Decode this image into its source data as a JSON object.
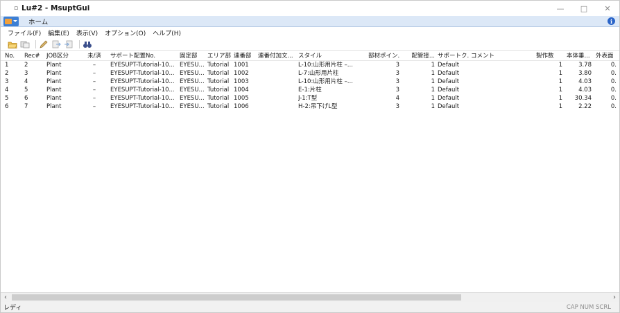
{
  "titlebar": {
    "glyph": "▫",
    "title": "Lu#2 - MsuptGui",
    "minimize": "—",
    "maximize": "□",
    "close": "✕"
  },
  "ribbon": {
    "home_tab": "ホーム",
    "info": "i"
  },
  "menu": [
    "ファイル(F)",
    "編集(E)",
    "表示(V)",
    "オプション(O)",
    "ヘルプ(H)"
  ],
  "toolbar": {
    "icons": [
      "open-folder-icon",
      "copy-rows-icon",
      "edit-pencil-icon",
      "export-icon",
      "import-icon",
      "find-binoculars-icon"
    ]
  },
  "columns": [
    "No.",
    "Rec#",
    "JOB区分",
    "未/済",
    "サポート配置No.",
    "固定部",
    "エリア部",
    "連番部",
    "連番付加文...",
    "スタイル",
    "部材ポイン...",
    "配管接...",
    "サポートク...",
    "コメント",
    "製作数",
    "本体垂...",
    "外表面"
  ],
  "rows": [
    [
      "1",
      "2",
      "Plant",
      "–",
      "EYESUPT-Tutorial-10...",
      "EYESU...",
      "Tutorial",
      "1001",
      "",
      "L-10:山形用片柱 –...",
      "3",
      "1",
      "Default",
      "",
      "1",
      "3.78",
      "0."
    ],
    [
      "2",
      "3",
      "Plant",
      "–",
      "EYESUPT-Tutorial-10...",
      "EYESU...",
      "Tutorial",
      "1002",
      "",
      "L-7:山形用片柱",
      "3",
      "1",
      "Default",
      "",
      "1",
      "3.80",
      "0."
    ],
    [
      "3",
      "4",
      "Plant",
      "–",
      "EYESUPT-Tutorial-10...",
      "EYESU...",
      "Tutorial",
      "1003",
      "",
      "L-10:山形用片柱 –...",
      "3",
      "1",
      "Default",
      "",
      "1",
      "4.03",
      "0."
    ],
    [
      "4",
      "5",
      "Plant",
      "–",
      "EYESUPT-Tutorial-10...",
      "EYESU...",
      "Tutorial",
      "1004",
      "",
      "E-1:片柱",
      "3",
      "1",
      "Default",
      "",
      "1",
      "4.03",
      "0."
    ],
    [
      "5",
      "6",
      "Plant",
      "–",
      "EYESUPT-Tutorial-10...",
      "EYESU...",
      "Tutorial",
      "1005",
      "",
      "J-1:T型",
      "4",
      "1",
      "Default",
      "",
      "1",
      "30.34",
      "0."
    ],
    [
      "6",
      "7",
      "Plant",
      "–",
      "EYESUPT-Tutorial-10...",
      "EYESU...",
      "Tutorial",
      "1006",
      "",
      "H-2:吊下げL型",
      "3",
      "1",
      "Default",
      "",
      "1",
      "2.22",
      "0."
    ]
  ],
  "scrollbar": {
    "left_arrow": "‹",
    "right_arrow": "›"
  },
  "status": {
    "text": "レディ",
    "indicators": "CAP NUM SCRL"
  },
  "colors": {
    "ribbon_bg": "#dce8f7",
    "app_button": "#3d7fd4",
    "info_icon": "#2a64c8"
  }
}
